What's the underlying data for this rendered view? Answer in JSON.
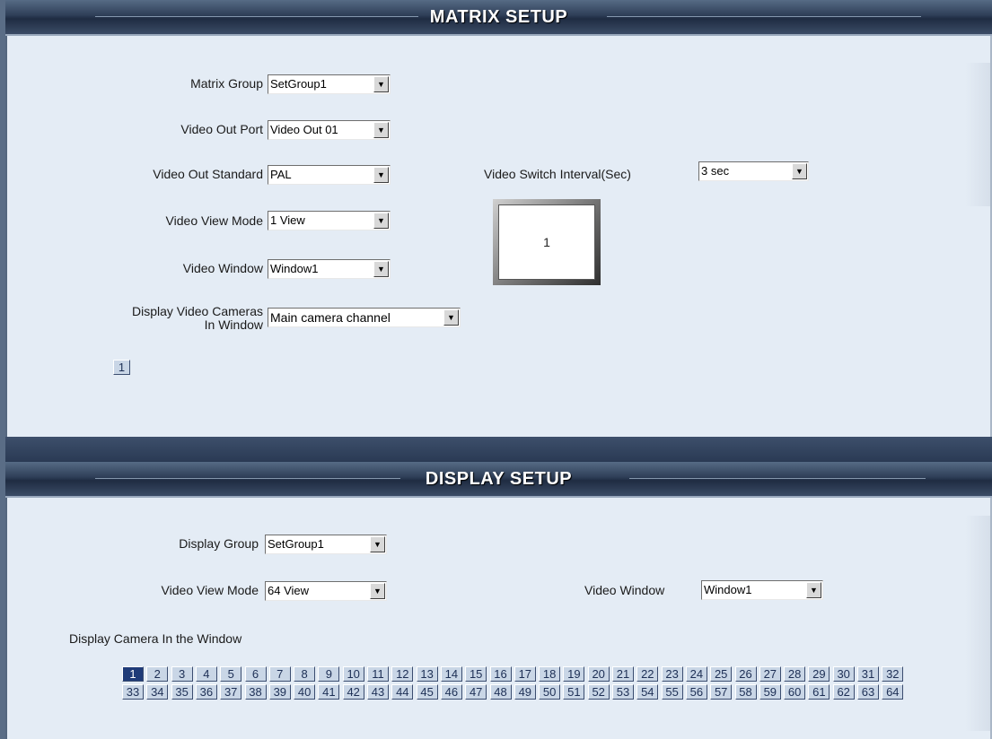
{
  "matrix": {
    "title": "MATRIX SETUP",
    "group_label": "Matrix Group",
    "group_value": "SetGroup1",
    "out_port_label": "Video Out Port",
    "out_port_value": "Video Out 01",
    "standard_label": "Video Out Standard",
    "standard_value": "PAL",
    "view_mode_label": "Video View Mode",
    "view_mode_value": "1 View",
    "window_label": "Video Window",
    "window_value": "Window1",
    "display_cams_label_1": "Display Video Cameras",
    "display_cams_label_2": "In Window",
    "display_cams_value": "Main camera channel",
    "switch_interval_label": "Video Switch Interval(Sec)",
    "switch_interval_value": "3 sec",
    "preview_number": "1",
    "camera_button": "1"
  },
  "display": {
    "title": "DISPLAY SETUP",
    "group_label": "Display Group",
    "group_value": "SetGroup1",
    "view_mode_label": "Video View Mode",
    "view_mode_value": "64 View",
    "window_label": "Video Window",
    "window_value": "Window1",
    "camera_label": "Display Camera In the Window",
    "selected_camera": "1",
    "cameras": [
      "1",
      "2",
      "3",
      "4",
      "5",
      "6",
      "7",
      "8",
      "9",
      "10",
      "11",
      "12",
      "13",
      "14",
      "15",
      "16",
      "17",
      "18",
      "19",
      "20",
      "21",
      "22",
      "23",
      "24",
      "25",
      "26",
      "27",
      "28",
      "29",
      "30",
      "31",
      "32",
      "33",
      "34",
      "35",
      "36",
      "37",
      "38",
      "39",
      "40",
      "41",
      "42",
      "43",
      "44",
      "45",
      "46",
      "47",
      "48",
      "49",
      "50",
      "51",
      "52",
      "53",
      "54",
      "55",
      "56",
      "57",
      "58",
      "59",
      "60",
      "61",
      "62",
      "63",
      "64"
    ]
  },
  "icons": {
    "dropdown": "triangle-down-icon"
  }
}
